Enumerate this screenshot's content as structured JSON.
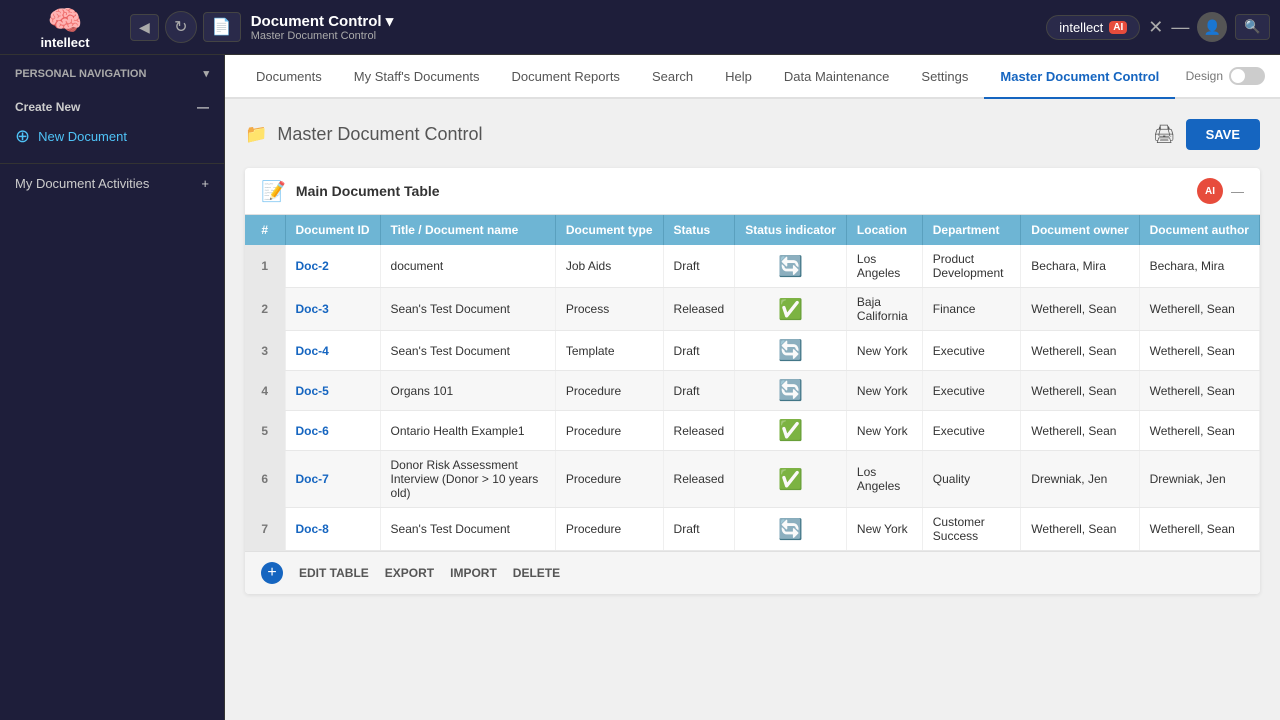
{
  "topbar": {
    "logo_text": "intellect",
    "logo_icon": "🧠",
    "app_title": "Document Control ▾",
    "app_subtitle": "Master Document Control",
    "intellect_label": "intellect",
    "ai_label": "AI",
    "save_label": "SAVE"
  },
  "nav_tabs": {
    "tabs": [
      {
        "label": "Documents",
        "active": false
      },
      {
        "label": "My Staff's Documents",
        "active": false
      },
      {
        "label": "Document Reports",
        "active": false
      },
      {
        "label": "Search",
        "active": false
      },
      {
        "label": "Help",
        "active": false
      },
      {
        "label": "Data Maintenance",
        "active": false
      },
      {
        "label": "Settings",
        "active": false
      },
      {
        "label": "Master Document Control",
        "active": true
      }
    ],
    "design_label": "Design"
  },
  "sidebar": {
    "nav_header": "PERSONAL NAVIGATION",
    "create_section_title": "Create New",
    "new_document_label": "New Document",
    "activities_label": "My Document Activities"
  },
  "page": {
    "title": "Master Document Control",
    "folder_icon": "📁"
  },
  "table": {
    "name": "Main Document Table",
    "columns": [
      "#",
      "Document ID",
      "Title / Document name",
      "Document type",
      "Status",
      "Status indicator",
      "Location",
      "Department",
      "Document owner",
      "Document author"
    ],
    "rows": [
      {
        "num": "1",
        "doc_id": "Doc-2",
        "title": "document",
        "type": "Job Aids",
        "status": "Draft",
        "indicator": "yellow",
        "location": "Los Angeles",
        "department": "Product Development",
        "owner": "Bechara, Mira",
        "author": "Bechara, Mira"
      },
      {
        "num": "2",
        "doc_id": "Doc-3",
        "title": "Sean's Test Document",
        "type": "Process",
        "status": "Released",
        "indicator": "green",
        "location": "Baja California",
        "department": "Finance",
        "owner": "Wetherell, Sean",
        "author": "Wetherell, Sean"
      },
      {
        "num": "3",
        "doc_id": "Doc-4",
        "title": "Sean's Test Document",
        "type": "Template",
        "status": "Draft",
        "indicator": "yellow",
        "location": "New York",
        "department": "Executive",
        "owner": "Wetherell, Sean",
        "author": "Wetherell, Sean"
      },
      {
        "num": "4",
        "doc_id": "Doc-5",
        "title": "Organs 101",
        "type": "Procedure",
        "status": "Draft",
        "indicator": "yellow",
        "location": "New York",
        "department": "Executive",
        "owner": "Wetherell, Sean",
        "author": "Wetherell, Sean"
      },
      {
        "num": "5",
        "doc_id": "Doc-6",
        "title": "Ontario Health Example1",
        "type": "Procedure",
        "status": "Released",
        "indicator": "green",
        "location": "New York",
        "department": "Executive",
        "owner": "Wetherell, Sean",
        "author": "Wetherell, Sean"
      },
      {
        "num": "6",
        "doc_id": "Doc-7",
        "title": "Donor Risk Assessment Interview (Donor > 10 years old)",
        "type": "Procedure",
        "status": "Released",
        "indicator": "green",
        "location": "Los Angeles",
        "department": "Quality",
        "owner": "Drewniak, Jen",
        "author": "Drewniak, Jen"
      },
      {
        "num": "7",
        "doc_id": "Doc-8",
        "title": "Sean's Test Document",
        "type": "Procedure",
        "status": "Draft",
        "indicator": "yellow",
        "location": "New York",
        "department": "Customer Success",
        "owner": "Wetherell, Sean",
        "author": "Wetherell, Sean"
      }
    ],
    "footer_actions": [
      "EDIT TABLE",
      "EXPORT",
      "IMPORT",
      "DELETE"
    ]
  }
}
